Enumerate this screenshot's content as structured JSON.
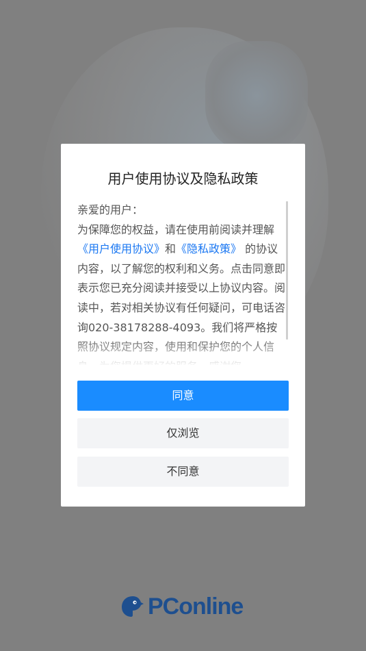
{
  "dialog": {
    "title": "用户使用协议及隐私政策",
    "greeting": "亲爱的用户：",
    "intro": "为保障您的权益，请在使用前阅读并理解",
    "link_terms": "《用户使用协议》",
    "and": "和",
    "link_privacy": "《隐私政策》",
    "body": " 的协议内容，以了解您的权利和义务。点击同意即表示您已充分阅读并接受以上协议内容。阅读中，若对相关协议有任何疑问，可电话咨询020-38178288-4093。我们将严格按照协议规定内容，使用和保护您的个人信息，为您提供更好的服务。感谢您"
  },
  "buttons": {
    "agree": "同意",
    "browse_only": "仅浏览",
    "disagree": "不同意"
  },
  "brand": {
    "name": "PConline",
    "color": "#1e4f8f",
    "logo_icon": "pconline-bird-icon"
  },
  "colors": {
    "primary": "#1a8cff",
    "link": "#1a77f2",
    "overlay": "#808080"
  }
}
